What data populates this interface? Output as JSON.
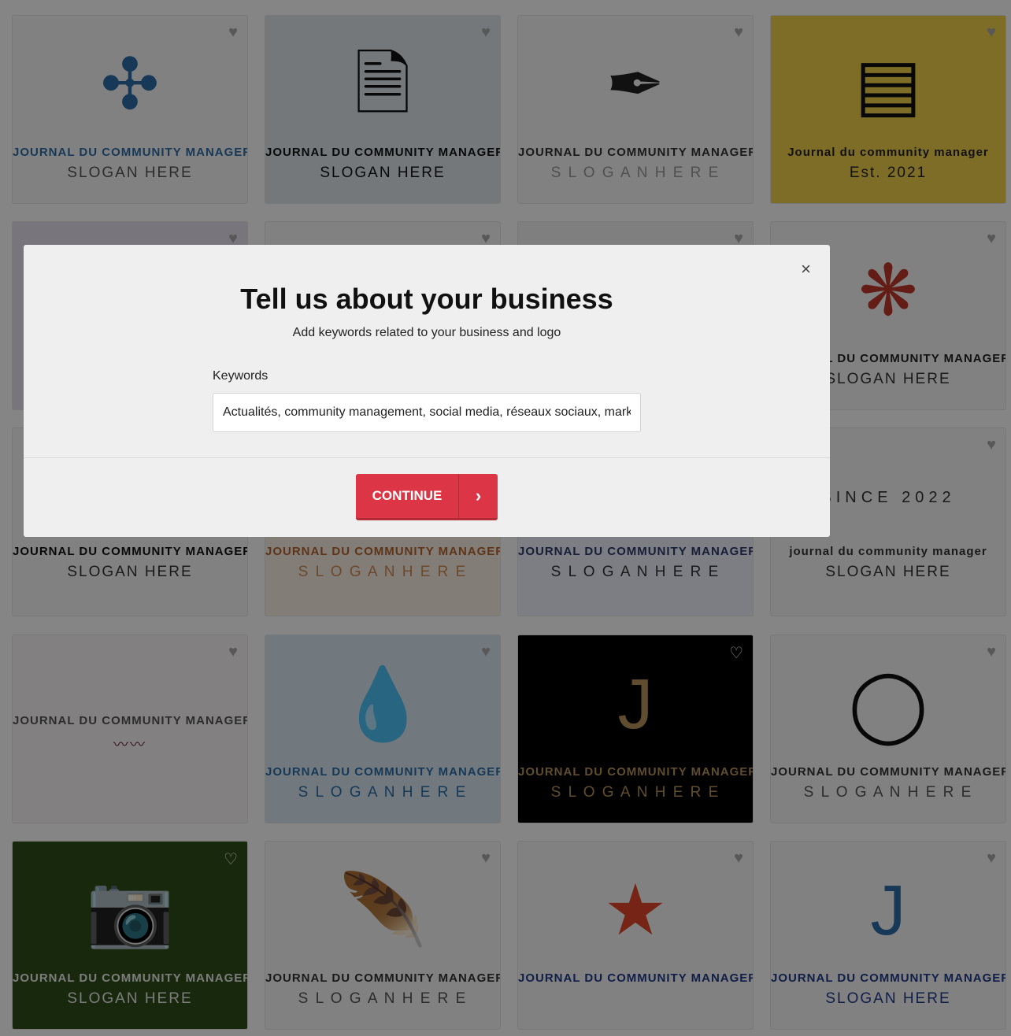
{
  "cards": [
    {
      "bg": "#f8f8f8",
      "logo": "✣",
      "logo_color": "#2d6ea8",
      "name": "JOURNAL DU COMMUNITY MANAGER",
      "name_color": "#2d6ea8",
      "slogan": "SLOGAN HERE",
      "slogan_color": "#555",
      "favorited": false
    },
    {
      "bg": "#dfe6ea",
      "logo": "🗎",
      "logo_color": "#111",
      "name": "JOURNAL DU COMMUNITY MANAGER",
      "name_color": "#111",
      "slogan": "SLOGAN HERE",
      "slogan_color": "#111",
      "favorited": false
    },
    {
      "bg": "#f8f8f8",
      "logo": "✒",
      "logo_color": "#222",
      "name": "JOURNAL DU COMMUNITY MANAGER",
      "name_color": "#333",
      "slogan": "S L O G A N   H E R E",
      "slogan_color": "#999",
      "favorited": false
    },
    {
      "bg": "#f2d24a",
      "logo": "▤",
      "logo_color": "#111",
      "name": "Journal du community manager",
      "name_color": "#222",
      "slogan": "Est. 2021",
      "slogan_color": "#222",
      "favorited": false
    },
    {
      "bg": "#e6e2ee",
      "logo": "",
      "logo_color": "#222",
      "name": "",
      "name_color": "#222",
      "slogan": "",
      "slogan_color": "#222",
      "favorited": false
    },
    {
      "bg": "#f8f8f8",
      "logo": "",
      "logo_color": "#222",
      "name": "",
      "name_color": "#222",
      "slogan": "",
      "slogan_color": "#222",
      "favorited": false
    },
    {
      "bg": "#f3f3f3",
      "logo": "",
      "logo_color": "#222",
      "name": "",
      "name_color": "#222",
      "slogan": "",
      "slogan_color": "#222",
      "favorited": false
    },
    {
      "bg": "#f8f8f8",
      "logo": "❋",
      "logo_color": "#c0392b",
      "name": "JOURNAL DU COMMUNITY MANAGER",
      "name_color": "#222",
      "slogan": "SLOGAN HERE",
      "slogan_color": "#333",
      "favorited": false
    },
    {
      "bg": "#f8f8f8",
      "logo": "",
      "logo_color": "#222",
      "name": "JOURNAL DU COMMUNITY MANAGER",
      "name_color": "#111",
      "slogan": "SLOGAN HERE",
      "slogan_color": "#333",
      "favorited": false
    },
    {
      "bg": "#fbefe6",
      "logo": "",
      "logo_color": "#c0763a",
      "name": "JOURNAL DU COMMUNITY MANAGER",
      "name_color": "#b5652e",
      "slogan": "S L O G A N   H E R E",
      "slogan_color": "#d08a55",
      "favorited": false
    },
    {
      "bg": "#eef1fb",
      "logo": "",
      "logo_color": "#2b3a6b",
      "name": "JOURNAL DU COMMUNITY MANAGER",
      "name_color": "#2b3a6b",
      "slogan": "S L O G A N   H E R E",
      "slogan_color": "#333",
      "favorited": false
    },
    {
      "bg": "#f8f8f8",
      "logo": "SINCE 2022",
      "logo_color": "#333",
      "name": "journal du community manager",
      "name_color": "#333",
      "slogan": "SLOGAN HERE",
      "slogan_color": "#333",
      "favorited": false
    },
    {
      "bg": "#faf6f8",
      "logo": "",
      "logo_color": "#6b2a3a",
      "name": "JOURNAL DU COMMUNITY MANAGER",
      "name_color": "#555",
      "slogan": "〰〰",
      "slogan_color": "#6b2a3a",
      "favorited": false
    },
    {
      "bg": "#dbe8f2",
      "logo": "💧",
      "logo_color": "#2d6ea8",
      "name": "JOURNAL DU COMMUNITY MANAGER",
      "name_color": "#2d6ea8",
      "slogan": "S L O G A N   H E R E",
      "slogan_color": "#2d6ea8",
      "favorited": false
    },
    {
      "bg": "#000000",
      "logo": "J",
      "logo_color": "#b8945a",
      "name": "JOURNAL DU COMMUNITY MANAGER",
      "name_color": "#b8945a",
      "slogan": "S L O G A N   H E R E",
      "slogan_color": "#b8945a",
      "favorited": false
    },
    {
      "bg": "#f8f8f8",
      "logo": "◯",
      "logo_color": "#111",
      "name": "JOURNAL DU COMMUNITY MANAGER",
      "name_color": "#333",
      "slogan": "S L O G A N   H E R E",
      "slogan_color": "#555",
      "favorited": false
    },
    {
      "bg": "#2e4d1a",
      "logo": "📷",
      "logo_color": "#ddd",
      "name": "JOURNAL DU COMMUNITY MANAGER",
      "name_color": "#eee",
      "slogan": "SLOGAN HERE",
      "slogan_color": "#eee",
      "favorited": false
    },
    {
      "bg": "#f8f8f8",
      "logo": "🪶",
      "logo_color": "#7b3fa0",
      "name": "JOURNAL DU COMMUNITY MANAGER",
      "name_color": "#333",
      "slogan": "S L O G A N   H E R E",
      "slogan_color": "#555",
      "favorited": false
    },
    {
      "bg": "#f8f8f8",
      "logo": "★",
      "logo_color": "#e0462a",
      "name": "JOURNAL DU COMMUNITY MANAGER",
      "name_color": "#1f3a8a",
      "slogan": "",
      "slogan_color": "#1f3a8a",
      "favorited": false
    },
    {
      "bg": "#f8f8f8",
      "logo": "J",
      "logo_color": "#2d6ea8",
      "name": "JOURNAL DU COMMUNITY MANAGER",
      "name_color": "#1f3a8a",
      "slogan": "SLOGAN HERE",
      "slogan_color": "#1f3a8a",
      "favorited": false
    }
  ],
  "modal": {
    "title": "Tell us about your business",
    "subtitle": "Add keywords related to your business and logo",
    "keywords_label": "Keywords",
    "keywords_value": "Actualités, community management, social media, réseaux sociaux, marketi",
    "continue_label": "CONTINUE",
    "close_icon": "×",
    "arrow_icon": "›",
    "accent": "#dc3545"
  }
}
